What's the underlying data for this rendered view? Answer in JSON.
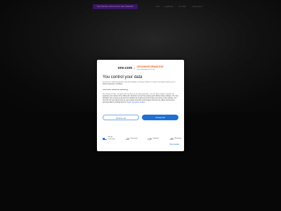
{
  "header": {
    "banner_text": "Sie befinden sich auf der alten Website",
    "nav": [
      "Info",
      "Angebote",
      "Kontakt",
      "Impressum"
    ]
  },
  "consent": {
    "brand_one": "one.com",
    "brand_plus": "+",
    "brand_partner": "CROSSINFORMATION",
    "brand_partner_sub": "Content Management Partner",
    "title": "You control your data",
    "intro": "We and our business partners use technologies, including cookies, to collect information about you for various purposes, including:",
    "purposes": "Functional, Statistical, Marketing",
    "details": "By clicking 'Accept', you give your consent for all these purposes. You can also choose to specify the purposes you consent to by ticking the checkbox next to the purpose and clicking 'Save settings'. You may withdraw your consent at any time by clicking the small icon at the bottom left corner of the website. You can find out more about how we use cookies and other technologies and how we collect and process personal data by clicking the link.",
    "read_more": "Read more about cookies",
    "decline_label": "Decline all",
    "accept_label": "Accept all",
    "categories": [
      {
        "label_line1": "Strictly",
        "label_line2": "necessary",
        "on": true
      },
      {
        "label_line1": "Functional",
        "label_line2": "",
        "on": false
      },
      {
        "label_line1": "Statistics",
        "label_line2": "",
        "on": false
      },
      {
        "label_line1": "Marketing",
        "label_line2": "",
        "on": false
      }
    ],
    "show_details": "Show details"
  },
  "colors": {
    "accent": "#1f6fd6",
    "banner": "#5b1fa0",
    "brand_orange": "#e8631a"
  }
}
